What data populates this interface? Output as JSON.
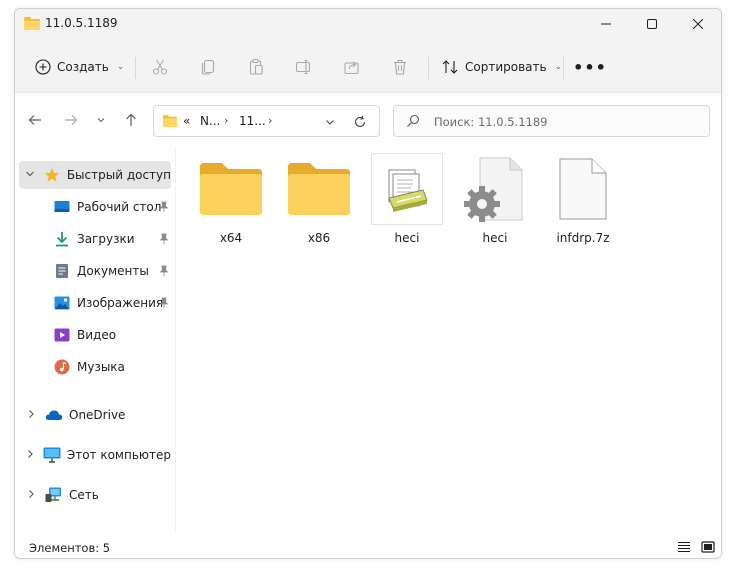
{
  "window": {
    "title": "11.0.5.1189"
  },
  "command_bar": {
    "create_label": "Создать",
    "sort_label": "Сортировать",
    "more_label": "•••"
  },
  "address_bar": {
    "prefix": "«",
    "segments": [
      "N...",
      "11..."
    ]
  },
  "search": {
    "placeholder": "Поиск: 11.0.5.1189"
  },
  "sidebar": {
    "quick_access": "Быстрый доступ",
    "items": [
      {
        "label": "Рабочий стол",
        "icon": "desktop-icon"
      },
      {
        "label": "Загрузки",
        "icon": "downloads-icon"
      },
      {
        "label": "Документы",
        "icon": "documents-icon"
      },
      {
        "label": "Изображения",
        "icon": "pictures-icon"
      },
      {
        "label": "Видео",
        "icon": "videos-icon"
      },
      {
        "label": "Музыка",
        "icon": "music-icon"
      }
    ],
    "onedrive": "OneDrive",
    "this_pc": "Этот компьютер",
    "network": "Сеть"
  },
  "files": [
    {
      "name": "x64",
      "type": "folder"
    },
    {
      "name": "x86",
      "type": "folder"
    },
    {
      "name": "heci",
      "type": "setup-information"
    },
    {
      "name": "heci",
      "type": "system-file"
    },
    {
      "name": "infdrp.7z",
      "type": "generic-file"
    }
  ],
  "status": {
    "items_text": "Элементов: 5"
  },
  "colors": {
    "folder_yellow": "#f8c83c",
    "selected_bg": "#e5e5e5",
    "chrome_bg": "#f3f3f3",
    "accent_blue": "#0067c0"
  }
}
